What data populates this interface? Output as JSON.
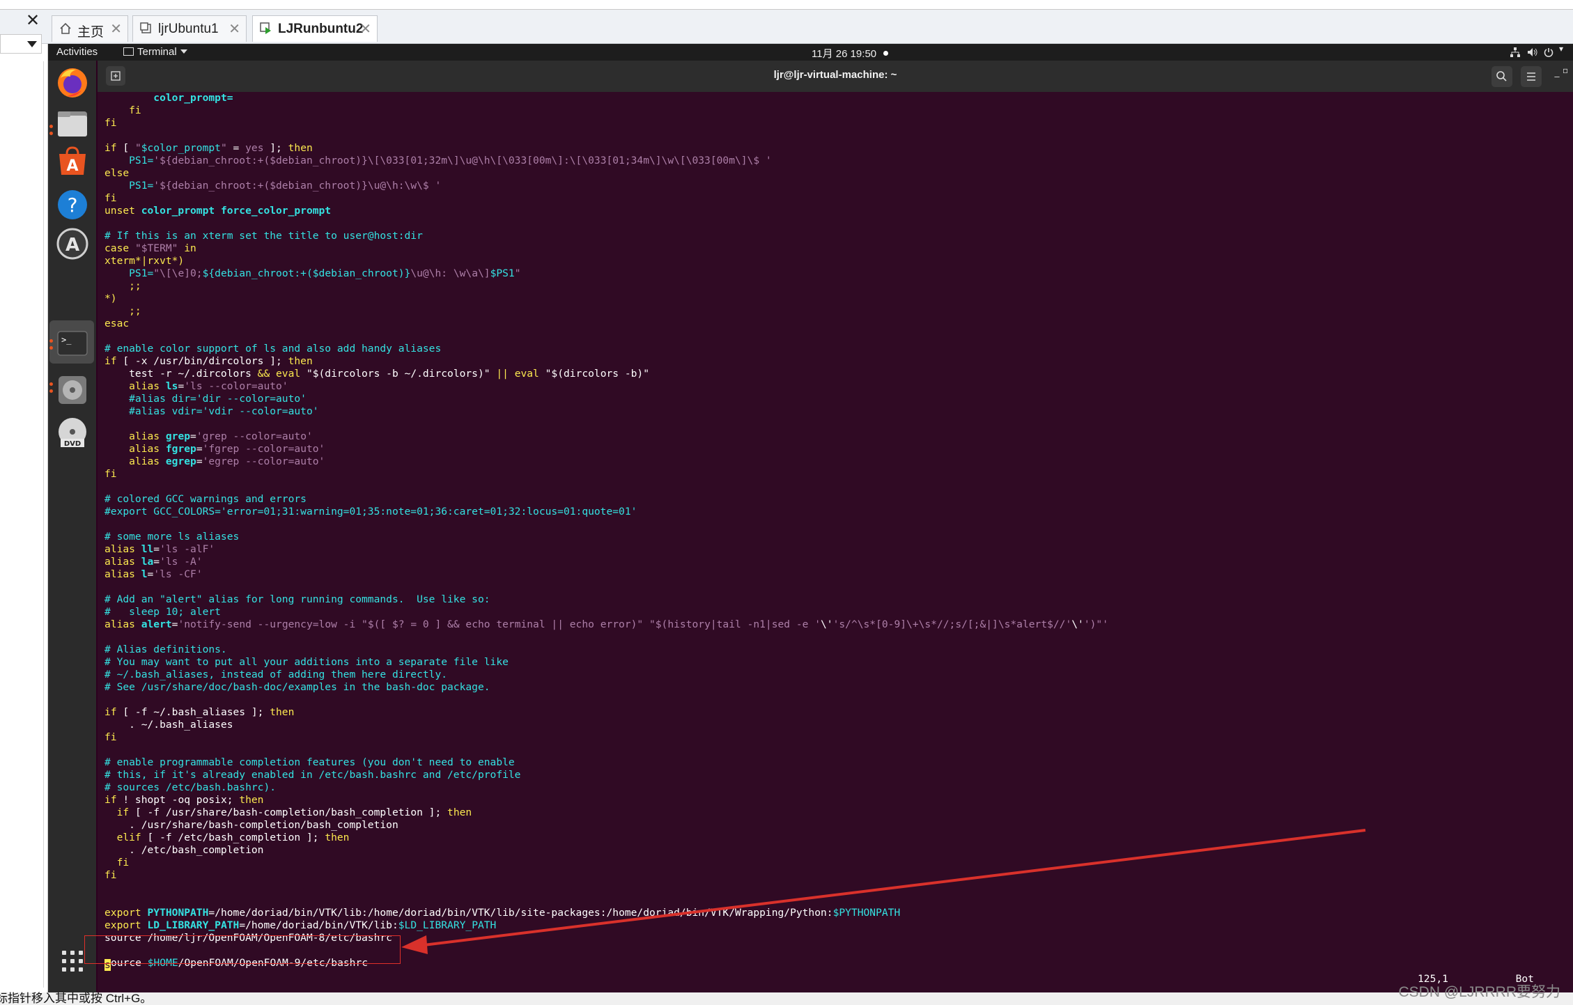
{
  "vmware": {
    "tabs": [
      {
        "label": "主页",
        "icon": "home-icon"
      },
      {
        "label": "ljrUbuntu1",
        "icon": "vm-icon"
      },
      {
        "label": "LJRunbuntu2",
        "icon": "vm-running-icon"
      }
    ],
    "status_text": "标指针移入其中或按 Ctrl+G。"
  },
  "watermark": "CSDN @LJRRRR要努力",
  "ubuntu": {
    "activities_label": "Activities",
    "app_menu_label": "Terminal",
    "clock": "11月 26  19:50",
    "dock_icons": [
      "firefox-icon",
      "files-icon",
      "software-icon",
      "help-icon",
      "updater-icon",
      "terminal-icon",
      "disc-icon",
      "dvd-icon"
    ]
  },
  "terminal": {
    "title": "ljr@ljr-virtual-machine: ~",
    "cursor_position": "125,1",
    "scroll_indicator": "Bot",
    "lines": [
      [
        [
          "        ",
          "c-pl"
        ],
        [
          "color_prompt=",
          "c-ct"
        ]
      ],
      [
        [
          "    fi",
          "c-kw"
        ]
      ],
      [
        [
          "fi",
          "c-kw"
        ]
      ],
      [],
      [
        [
          "if",
          "c-kw"
        ],
        [
          " [ ",
          "c-pl"
        ],
        [
          "\"",
          "c-st"
        ],
        [
          "$color_prompt",
          "c-vr"
        ],
        [
          "\"",
          "c-st"
        ],
        [
          " = ",
          "c-pl"
        ],
        [
          "yes",
          "c-st"
        ],
        [
          " ]; ",
          "c-pl"
        ],
        [
          "then",
          "c-kw"
        ]
      ],
      [
        [
          "    PS1=",
          "c-vr"
        ],
        [
          "'${debian_chroot:+($debian_chroot)}\\[\\033[01;32m\\]\\u@\\h\\[\\033[00m\\]:\\[\\033[01;34m\\]\\w\\[\\033[00m\\]\\$ '",
          "c-st"
        ]
      ],
      [
        [
          "else",
          "c-kw"
        ]
      ],
      [
        [
          "    PS1=",
          "c-vr"
        ],
        [
          "'${debian_chroot:+($debian_chroot)}\\u@\\h:\\w\\$ '",
          "c-st"
        ]
      ],
      [
        [
          "fi",
          "c-kw"
        ]
      ],
      [
        [
          "unset ",
          "c-kw"
        ],
        [
          "color_prompt force_color_prompt",
          "c-ct"
        ]
      ],
      [],
      [
        [
          "# If this is an xterm set the title to user@host:dir",
          "c-cm"
        ]
      ],
      [
        [
          "case",
          "c-kw"
        ],
        [
          " ",
          "c-pl"
        ],
        [
          "\"$TERM\"",
          "c-st"
        ],
        [
          " in",
          "c-kw"
        ]
      ],
      [
        [
          "xterm*|rxvt*)",
          "c-kw"
        ]
      ],
      [
        [
          "    PS1=",
          "c-vr"
        ],
        [
          "\"\\[\\e]0;",
          "c-st"
        ],
        [
          "${debian_chroot:+($debian_chroot)}",
          "c-vr"
        ],
        [
          "\\u@\\h: \\w\\a\\]",
          "c-st"
        ],
        [
          "$PS1",
          "c-vr"
        ],
        [
          "\"",
          "c-st"
        ]
      ],
      [
        [
          "    ;;",
          "c-kw"
        ]
      ],
      [
        [
          "*)",
          "c-kw"
        ]
      ],
      [
        [
          "    ;;",
          "c-kw"
        ]
      ],
      [
        [
          "esac",
          "c-kw"
        ]
      ],
      [],
      [
        [
          "# enable color support of ls and also add handy aliases",
          "c-cm"
        ]
      ],
      [
        [
          "if",
          "c-kw"
        ],
        [
          " [ -x /usr/bin/dircolors ]; ",
          "c-pl"
        ],
        [
          "then",
          "c-kw"
        ]
      ],
      [
        [
          "    test -r ~/.dircolors ",
          "c-pl"
        ],
        [
          "&&",
          "c-kw"
        ],
        [
          " eval ",
          "c-kw"
        ],
        [
          "\"$(dircolors -b ~/.dircolors)\"",
          "c-pl"
        ],
        [
          " || ",
          "c-kw"
        ],
        [
          "eval ",
          "c-kw"
        ],
        [
          "\"$(dircolors -b)\"",
          "c-pl"
        ]
      ],
      [
        [
          "    alias ",
          "c-kw"
        ],
        [
          "ls",
          "c-ct"
        ],
        [
          "=",
          "c-pl"
        ],
        [
          "'ls --color=auto'",
          "c-st"
        ]
      ],
      [
        [
          "    #alias dir='dir --color=auto'",
          "c-cm"
        ]
      ],
      [
        [
          "    #alias vdir='vdir --color=auto'",
          "c-cm"
        ]
      ],
      [],
      [
        [
          "    alias ",
          "c-kw"
        ],
        [
          "grep",
          "c-ct"
        ],
        [
          "=",
          "c-pl"
        ],
        [
          "'grep --color=auto'",
          "c-st"
        ]
      ],
      [
        [
          "    alias ",
          "c-kw"
        ],
        [
          "fgrep",
          "c-ct"
        ],
        [
          "=",
          "c-pl"
        ],
        [
          "'fgrep --color=auto'",
          "c-st"
        ]
      ],
      [
        [
          "    alias ",
          "c-kw"
        ],
        [
          "egrep",
          "c-ct"
        ],
        [
          "=",
          "c-pl"
        ],
        [
          "'egrep --color=auto'",
          "c-st"
        ]
      ],
      [
        [
          "fi",
          "c-kw"
        ]
      ],
      [],
      [
        [
          "# colored GCC warnings and errors",
          "c-cm"
        ]
      ],
      [
        [
          "#export GCC_COLORS='error=01;31:warning=01;35:note=01;36:caret=01;32:locus=01:quote=01'",
          "c-cm"
        ]
      ],
      [],
      [
        [
          "# some more ls aliases",
          "c-cm"
        ]
      ],
      [
        [
          "alias ",
          "c-kw"
        ],
        [
          "ll",
          "c-ct"
        ],
        [
          "=",
          "c-pl"
        ],
        [
          "'ls -alF'",
          "c-st"
        ]
      ],
      [
        [
          "alias ",
          "c-kw"
        ],
        [
          "la",
          "c-ct"
        ],
        [
          "=",
          "c-pl"
        ],
        [
          "'ls -A'",
          "c-st"
        ]
      ],
      [
        [
          "alias ",
          "c-kw"
        ],
        [
          "l",
          "c-ct"
        ],
        [
          "=",
          "c-pl"
        ],
        [
          "'ls -CF'",
          "c-st"
        ]
      ],
      [],
      [
        [
          "# Add an \"alert\" alias for long running commands.  Use like so:",
          "c-cm"
        ]
      ],
      [
        [
          "#   sleep 10; alert",
          "c-cm"
        ]
      ],
      [
        [
          "alias ",
          "c-kw"
        ],
        [
          "alert",
          "c-ct"
        ],
        [
          "=",
          "c-pl"
        ],
        [
          "'notify-send --urgency=low -i \"$([ $? = 0 ] && echo terminal || echo error)\" \"$(history|tail -n1|sed -e '",
          "c-st"
        ],
        [
          "\\'",
          "c-pl"
        ],
        [
          "'s/^\\s*[0-9]\\+\\s*//;s/[;&|]\\s*alert$//'",
          "c-st"
        ],
        [
          "\\'",
          "c-pl"
        ],
        [
          "')\"'",
          "c-st"
        ]
      ],
      [],
      [
        [
          "# Alias definitions.",
          "c-cm"
        ]
      ],
      [
        [
          "# You may want to put all your additions into a separate file like",
          "c-cm"
        ]
      ],
      [
        [
          "# ~/.bash_aliases, instead of adding them here directly.",
          "c-cm"
        ]
      ],
      [
        [
          "# See /usr/share/doc/bash-doc/examples in the bash-doc package.",
          "c-cm"
        ]
      ],
      [],
      [
        [
          "if",
          "c-kw"
        ],
        [
          " [ -f ~/.bash_aliases ]; ",
          "c-pl"
        ],
        [
          "then",
          "c-kw"
        ]
      ],
      [
        [
          "    . ~/.bash_aliases",
          "c-pl"
        ]
      ],
      [
        [
          "fi",
          "c-kw"
        ]
      ],
      [],
      [
        [
          "# enable programmable completion features (you don't need to enable",
          "c-cm"
        ]
      ],
      [
        [
          "# this, if it's already enabled in /etc/bash.bashrc and /etc/profile",
          "c-cm"
        ]
      ],
      [
        [
          "# sources /etc/bash.bashrc).",
          "c-cm"
        ]
      ],
      [
        [
          "if",
          "c-kw"
        ],
        [
          " ! shopt -oq posix; ",
          "c-pl"
        ],
        [
          "then",
          "c-kw"
        ]
      ],
      [
        [
          "  if",
          "c-kw"
        ],
        [
          " [ -f /usr/share/bash-completion/bash_completion ]; ",
          "c-pl"
        ],
        [
          "then",
          "c-kw"
        ]
      ],
      [
        [
          "    . /usr/share/bash-completion/bash_completion",
          "c-pl"
        ]
      ],
      [
        [
          "  elif",
          "c-kw"
        ],
        [
          " [ -f /etc/bash_completion ]; ",
          "c-pl"
        ],
        [
          "then",
          "c-kw"
        ]
      ],
      [
        [
          "    . /etc/bash_completion",
          "c-pl"
        ]
      ],
      [
        [
          "  fi",
          "c-kw"
        ]
      ],
      [
        [
          "fi",
          "c-kw"
        ]
      ],
      [],
      [],
      [
        [
          "export ",
          "c-kw"
        ],
        [
          "PYTHONPATH",
          "c-ct"
        ],
        [
          "=/home/doriad/bin/VTK/lib:/home/doriad/bin/VTK/lib/site-packages:/home/doriad/bin/VTK/Wrapping/Python:",
          "c-pl"
        ],
        [
          "$PYTHONPATH",
          "c-vr"
        ]
      ],
      [
        [
          "export ",
          "c-kw"
        ],
        [
          "LD_LIBRARY_PATH",
          "c-ct"
        ],
        [
          "=/home/doriad/bin/VTK/lib:",
          "c-pl"
        ],
        [
          "$LD_LIBRARY_PATH",
          "c-vr"
        ]
      ],
      [
        [
          "source /home/ljr/OpenFOAM/OpenFOAM-8/etc/bashrc",
          "c-pl"
        ]
      ],
      [],
      [
        [
          "CURSOR",
          ""
        ],
        [
          "ource ",
          "c-pl"
        ],
        [
          "$HOME",
          "c-vr"
        ],
        [
          "/OpenFOAM/OpenFOAM-9/etc/bashrc",
          "c-pl"
        ]
      ]
    ]
  }
}
